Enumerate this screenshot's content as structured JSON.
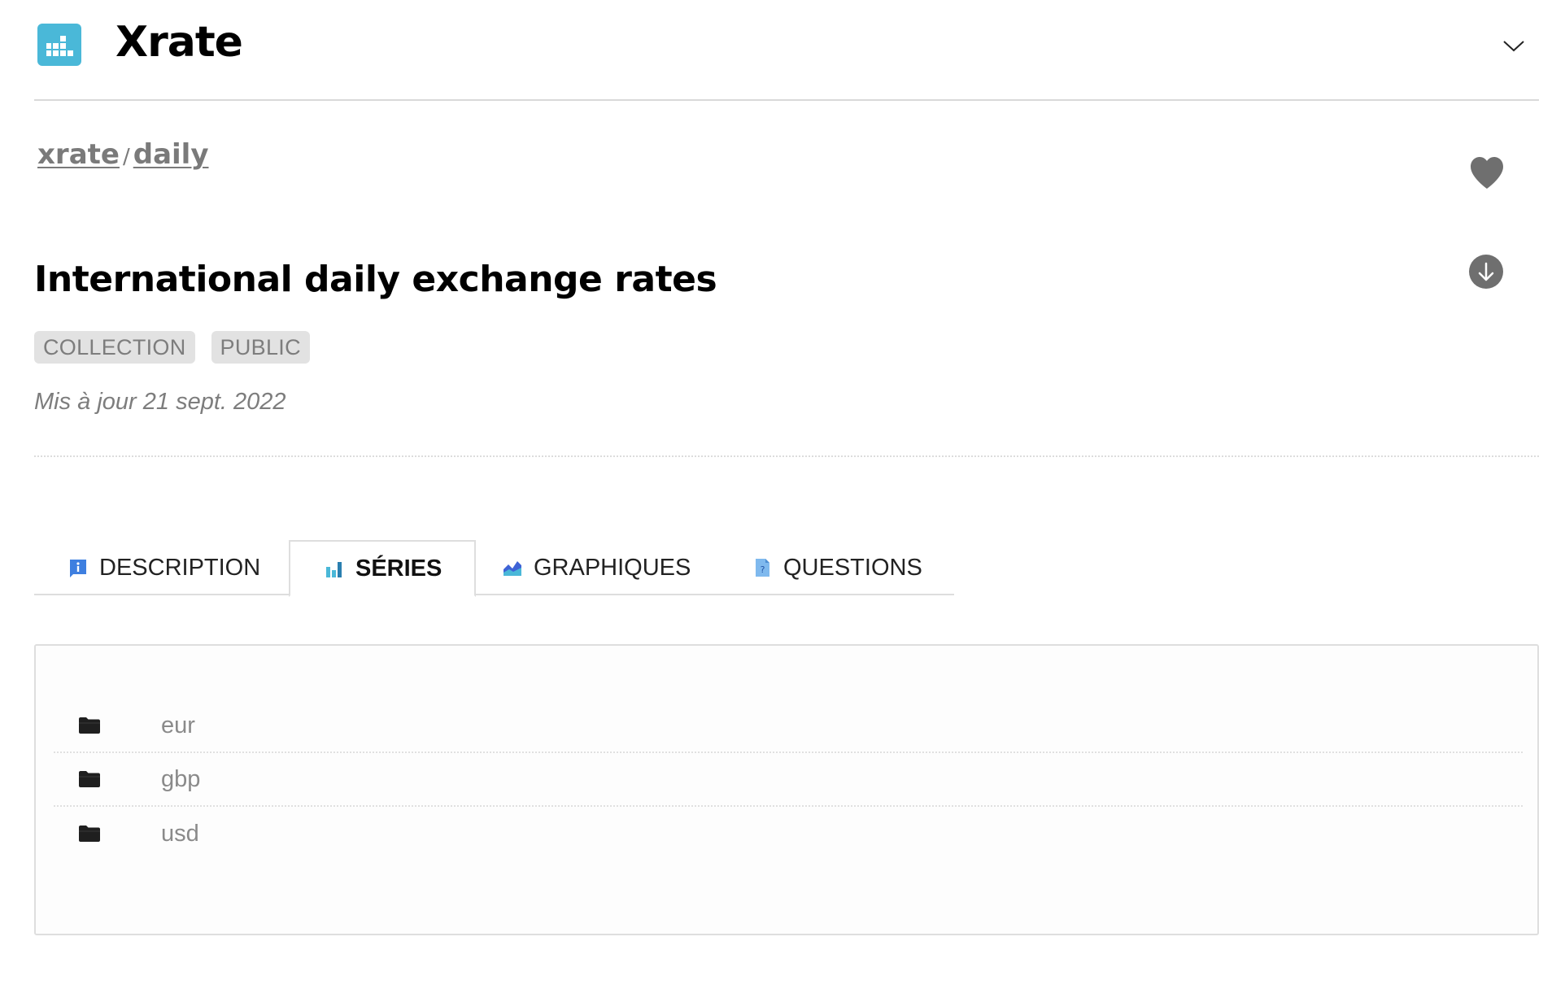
{
  "app": {
    "brand": "Xrate"
  },
  "breadcrumb": {
    "owner": "xrate",
    "separator": "/",
    "dataset": "daily"
  },
  "dataset": {
    "title": "International daily exchange rates",
    "badges": [
      "COLLECTION",
      "PUBLIC"
    ],
    "updated": "Mis à jour 21 sept. 2022"
  },
  "tabs": [
    {
      "label": "DESCRIPTION",
      "icon": "info-icon",
      "active": false
    },
    {
      "label": "SÉRIES",
      "icon": "bar-chart-icon",
      "active": true
    },
    {
      "label": "GRAPHIQUES",
      "icon": "area-chart-icon",
      "active": false
    },
    {
      "label": "QUESTIONS",
      "icon": "question-doc-icon",
      "active": false
    }
  ],
  "series": [
    {
      "name": "eur",
      "icon": "folder-icon"
    },
    {
      "name": "gbp",
      "icon": "folder-icon"
    },
    {
      "name": "usd",
      "icon": "folder-icon"
    }
  ],
  "colors": {
    "accent": "#4ab8d8",
    "icon_gray": "#6f6f6f",
    "badge_bg": "#e2e2e2"
  }
}
